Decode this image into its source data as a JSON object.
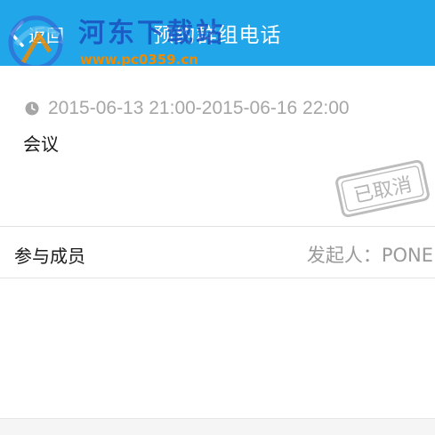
{
  "header": {
    "back_label": "返回",
    "title": "预约群组电话",
    "background_color": "#22a6ea"
  },
  "watermark": {
    "site_name": "河东下载站",
    "url": "www.pc0359.cn"
  },
  "meeting": {
    "time_range": "2015-06-13 21:00-2015-06-16 22:00",
    "subject": "会议",
    "status_stamp": "已取消"
  },
  "members": {
    "label": "参与成员",
    "initiator_label": "发起人：",
    "initiator_name": "PONE"
  },
  "icons": {
    "back": "chevron-left-icon",
    "clock": "clock-icon"
  }
}
